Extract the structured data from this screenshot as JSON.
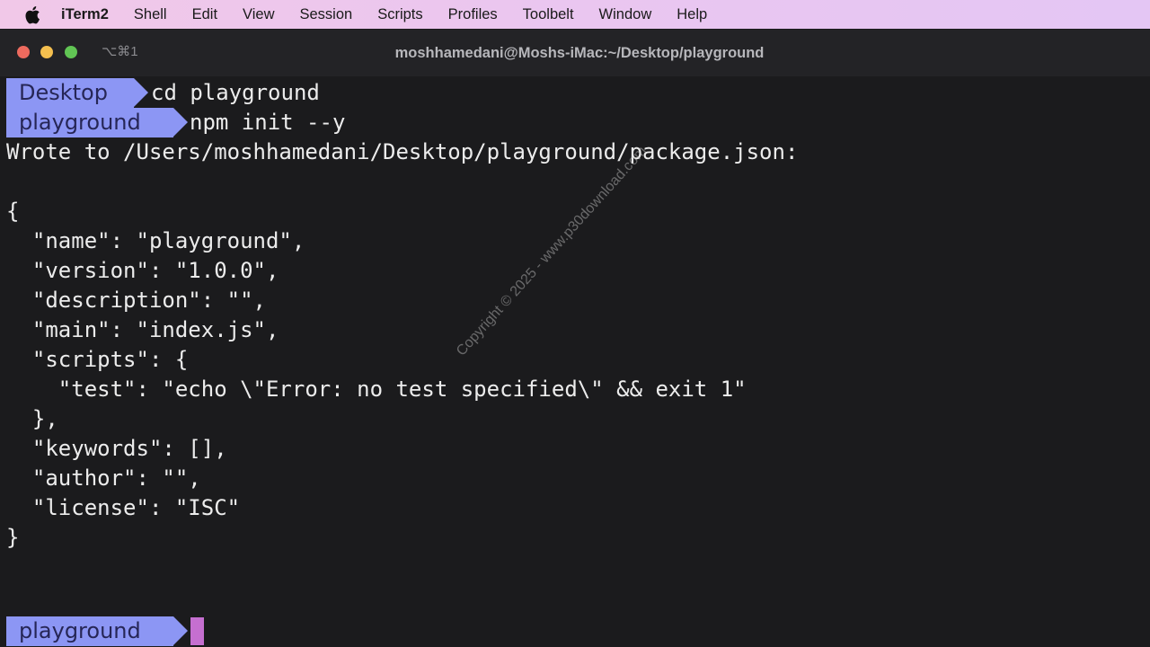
{
  "menubar": {
    "apple_icon": "apple-logo-icon",
    "app_name": "iTerm2",
    "items": [
      "Shell",
      "Edit",
      "View",
      "Session",
      "Scripts",
      "Profiles",
      "Toolbelt",
      "Window",
      "Help"
    ]
  },
  "window": {
    "shortcut": "⌥⌘1",
    "title": "moshhamedani@Moshs-iMac:~/Desktop/playground"
  },
  "terminal": {
    "prompt1": {
      "dir": "Desktop",
      "command": "cd playground"
    },
    "prompt2": {
      "dir": "playground",
      "command": "npm init --y"
    },
    "output": [
      "Wrote to /Users/moshhamedani/Desktop/playground/package.json:",
      "",
      "{",
      "  \"name\": \"playground\",",
      "  \"version\": \"1.0.0\",",
      "  \"description\": \"\",",
      "  \"main\": \"index.js\",",
      "  \"scripts\": {",
      "    \"test\": \"echo \\\"Error: no test specified\\\" && exit 1\"",
      "  },",
      "  \"keywords\": [],",
      "  \"author\": \"\",",
      "  \"license\": \"ISC\"",
      "}"
    ],
    "prompt3": {
      "dir": "playground",
      "command": ""
    }
  },
  "watermark": "Copyright © 2025 - www.p30download.com",
  "colors": {
    "prompt_bg": "#8c96f4",
    "prompt_fg": "#262656",
    "cursor": "#c56fd0",
    "terminal_bg": "#1b1b1d"
  }
}
